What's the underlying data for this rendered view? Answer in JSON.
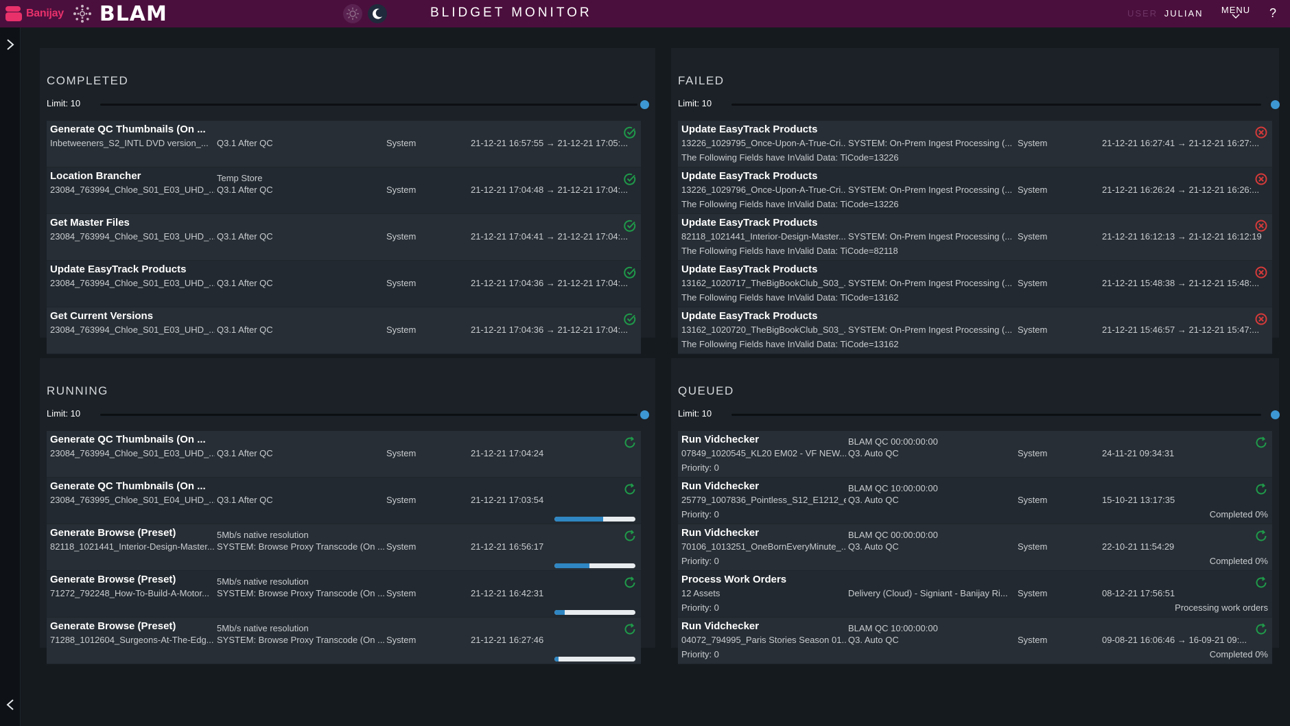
{
  "header": {
    "brand_name": "Banijay",
    "product_name": "BLAM",
    "app_title": "BLIDGET MONITOR",
    "user_label": "USER",
    "user_name": "JULIAN",
    "menu_label": "MENU",
    "help": "?"
  },
  "colors": {
    "topbar": "#4b0f3d",
    "brand_pink": "#e8316b",
    "success": "#1f9a4a",
    "failed": "#d63a3a",
    "accent_blue": "#3d97d3"
  },
  "panels": {
    "completed": {
      "title": "COMPLETED",
      "limit": "Limit: 10",
      "jobs": [
        {
          "title": "Generate QC Thumbnails (On ...",
          "tag": "",
          "asset": "Inbetweeners_S2_INTL DVD version_...",
          "workflow": "Q3.1 After QC",
          "user": "System",
          "time": "21-12-21 16:57:55 → 21-12-21 17:05:...",
          "status": "success"
        },
        {
          "title": "Location Brancher",
          "tag": "Temp Store",
          "asset": "23084_763994_Chloe_S01_E03_UHD_...",
          "workflow": "Q3.1 After QC",
          "user": "System",
          "time": "21-12-21 17:04:48 → 21-12-21 17:04:...",
          "status": "success"
        },
        {
          "title": "Get Master Files",
          "tag": "",
          "asset": "23084_763994_Chloe_S01_E03_UHD_...",
          "workflow": "Q3.1 After QC",
          "user": "System",
          "time": "21-12-21 17:04:41 → 21-12-21 17:04:...",
          "status": "success"
        },
        {
          "title": "Update EasyTrack Products",
          "tag": "",
          "asset": "23084_763994_Chloe_S01_E03_UHD_...",
          "workflow": "Q3.1 After QC",
          "user": "System",
          "time": "21-12-21 17:04:36 → 21-12-21 17:04:...",
          "status": "success"
        },
        {
          "title": "Get Current Versions",
          "tag": "",
          "asset": "23084_763994_Chloe_S01_E03_UHD_...",
          "workflow": "Q3.1 After QC",
          "user": "System",
          "time": "21-12-21 17:04:36 → 21-12-21 17:04:...",
          "status": "success"
        }
      ]
    },
    "failed": {
      "title": "FAILED",
      "limit": "Limit: 10",
      "jobs": [
        {
          "title": "Update EasyTrack Products",
          "asset": "13226_1029795_Once-Upon-A-True-Cri...",
          "workflow": "SYSTEM: On-Prem Ingest Processing (...",
          "user": "System",
          "time": "21-12-21 16:27:41 → 21-12-21 16:27:...",
          "error": "The Following Fields have InValid Data: TiCode=13226",
          "status": "failed"
        },
        {
          "title": "Update EasyTrack Products",
          "asset": "13226_1029796_Once-Upon-A-True-Cri...",
          "workflow": "SYSTEM: On-Prem Ingest Processing (...",
          "user": "System",
          "time": "21-12-21 16:26:24 → 21-12-21 16:26:...",
          "error": "The Following Fields have InValid Data: TiCode=13226",
          "status": "failed"
        },
        {
          "title": "Update EasyTrack Products",
          "asset": "82118_1021441_Interior-Design-Master...",
          "workflow": "SYSTEM: On-Prem Ingest Processing (...",
          "user": "System",
          "time": "21-12-21 16:12:13 → 21-12-21 16:12:19",
          "error": "The Following Fields have InValid Data: TiCode=82118",
          "status": "failed"
        },
        {
          "title": "Update EasyTrack Products",
          "asset": "13162_1020717_TheBigBookClub_S03_...",
          "workflow": "SYSTEM: On-Prem Ingest Processing (...",
          "user": "System",
          "time": "21-12-21 15:48:38 → 21-12-21 15:48:...",
          "error": "The Following Fields have InValid Data: TiCode=13162",
          "status": "failed"
        },
        {
          "title": "Update EasyTrack Products",
          "asset": "13162_1020720_TheBigBookClub_S03_...",
          "workflow": "SYSTEM: On-Prem Ingest Processing (...",
          "user": "System",
          "time": "21-12-21 15:46:57 → 21-12-21 15:47:...",
          "error": "The Following Fields have InValid Data: TiCode=13162",
          "status": "failed"
        }
      ]
    },
    "running": {
      "title": "RUNNING",
      "limit": "Limit: 10",
      "jobs": [
        {
          "title": "Generate QC Thumbnails (On ...",
          "tag": "",
          "asset": "23084_763994_Chloe_S01_E03_UHD_...",
          "workflow": "Q3.1 After QC",
          "user": "System",
          "time": "21-12-21 17:04:24",
          "progress": null
        },
        {
          "title": "Generate QC Thumbnails (On ...",
          "tag": "",
          "asset": "23084_763995_Chloe_S01_E04_UHD_...",
          "workflow": "Q3.1 After QC",
          "user": "System",
          "time": "21-12-21 17:03:54",
          "progress": 0.6
        },
        {
          "title": "Generate Browse (Preset)",
          "tag": "5Mb/s native resolution",
          "asset": "82118_1021441_Interior-Design-Master...",
          "workflow": "SYSTEM: Browse Proxy Transcode (On ...",
          "user": "System",
          "time": "21-12-21 16:56:17",
          "progress": 0.43
        },
        {
          "title": "Generate Browse (Preset)",
          "tag": "5Mb/s native resolution",
          "asset": "71272_792248_How-To-Build-A-Motor...",
          "workflow": "SYSTEM: Browse Proxy Transcode (On ...",
          "user": "System",
          "time": "21-12-21 16:42:31",
          "progress": 0.13
        },
        {
          "title": "Generate Browse (Preset)",
          "tag": "5Mb/s native resolution",
          "asset": "71288_1012604_Surgeons-At-The-Edg...",
          "workflow": "SYSTEM: Browse Proxy Transcode (On ...",
          "user": "System",
          "time": "21-12-21 16:27:46",
          "progress": 0.05
        }
      ]
    },
    "queued": {
      "title": "QUEUED",
      "limit": "Limit: 10",
      "jobs": [
        {
          "title": "Run Vidchecker",
          "tag": "BLAM QC 00:00:00:00",
          "asset": "07849_1020545_KL20 EM02 - VF NEW....",
          "workflow": "Q3. Auto QC",
          "user": "System",
          "time": "24-11-21 09:34:31",
          "priority": "Priority: 0",
          "note": ""
        },
        {
          "title": "Run Vidchecker",
          "tag": "BLAM QC 10:00:00:00",
          "asset": "25779_1007836_Pointless_S12_E1212_e...",
          "workflow": "Q3. Auto QC",
          "user": "System",
          "time": "15-10-21 13:17:35",
          "priority": "Priority: 0",
          "note": "Completed 0%"
        },
        {
          "title": "Run Vidchecker",
          "tag": "BLAM QC 00:00:00:00",
          "asset": "70106_1013251_OneBornEveryMinute_...",
          "workflow": "Q3. Auto QC",
          "user": "System",
          "time": "22-10-21 11:54:29",
          "priority": "Priority: 0",
          "note": "Completed 0%"
        },
        {
          "title": "Process Work Orders",
          "tag": "",
          "asset": "12 Assets",
          "workflow": "Delivery (Cloud) - Signiant - Banijay Ri...",
          "user": "System",
          "time": "08-12-21 17:56:51",
          "priority": "Priority: 0",
          "note": "Processing work orders"
        },
        {
          "title": "Run Vidchecker",
          "tag": "BLAM QC 10:00:00:00",
          "asset": "04072_794995_Paris Stories Season 01...",
          "workflow": "Q3. Auto QC",
          "user": "System",
          "time": "09-08-21 16:06:46 → 16-09-21 09:...",
          "priority": "Priority: 0",
          "note": "Completed 0%"
        }
      ]
    }
  }
}
